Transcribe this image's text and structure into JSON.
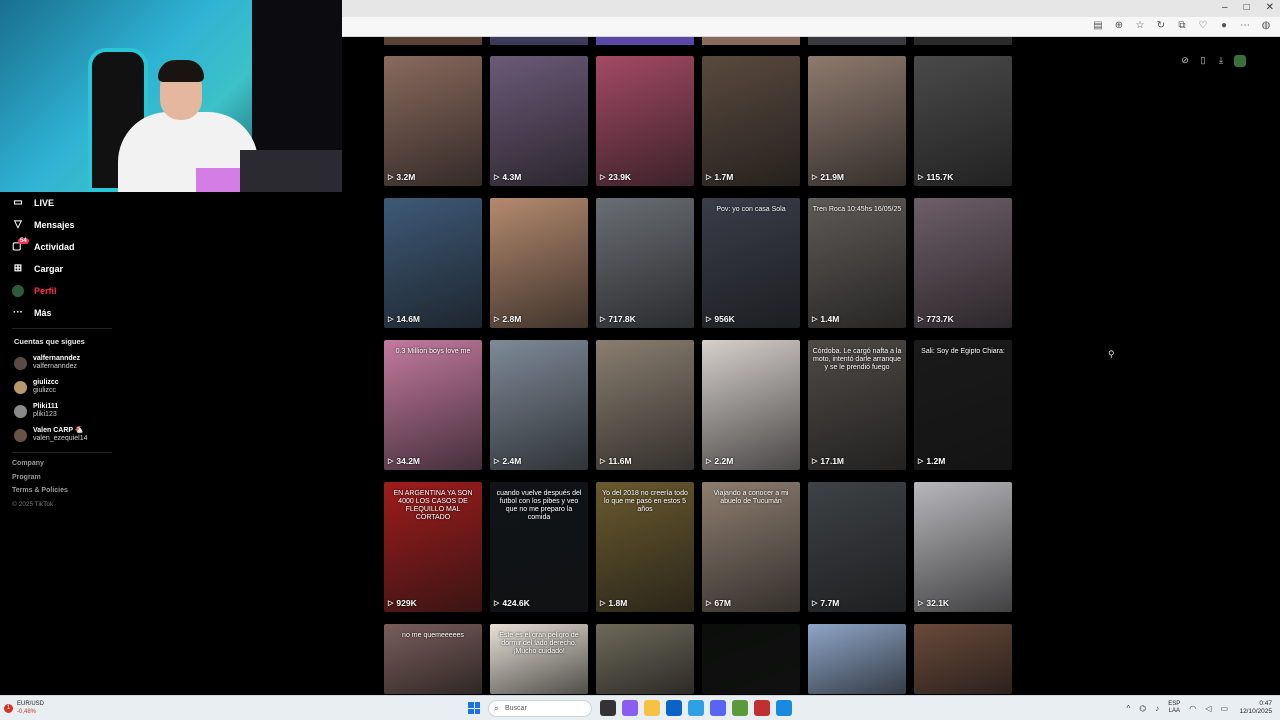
{
  "sidebar": {
    "items": [
      {
        "label": "LIVE",
        "icon": "live-tv-icon"
      },
      {
        "label": "Mensajes",
        "icon": "paper-plane-icon"
      },
      {
        "label": "Actividad",
        "icon": "inbox-icon",
        "badge": "54"
      },
      {
        "label": "Cargar",
        "icon": "plus-square-icon"
      },
      {
        "label": "Perfil",
        "icon": "avatar",
        "active": true
      },
      {
        "label": "Más",
        "icon": "more-dots-icon"
      }
    ],
    "following_title": "Cuentas que sigues",
    "following": [
      {
        "name": "valfernanndez",
        "handle": "valfernanndez"
      },
      {
        "name": "giulizcc",
        "handle": "giulizcc"
      },
      {
        "name": "Pliki111",
        "handle": "pliki123"
      },
      {
        "name": "Valen CARP 🐔",
        "handle": "valen_ezequiel14"
      }
    ],
    "footer": [
      "Company",
      "Program",
      "Terms & Policies"
    ],
    "copyright": "© 2025 TikTok"
  },
  "grid": {
    "rows": [
      [
        {
          "views": "3.2M",
          "color": "#8a6a5e"
        },
        {
          "views": "4.3M",
          "color": "#6c5a78"
        },
        {
          "views": "23.9K",
          "color": "#a44a66"
        },
        {
          "views": "1.7M",
          "color": "#5a4a3e"
        },
        {
          "views": "21.9M",
          "color": "#8e7a6e"
        },
        {
          "views": "115.7K",
          "color": "#4a4a4a"
        }
      ],
      [
        {
          "views": "14.6M",
          "color": "#3e5a78"
        },
        {
          "views": "2.8M",
          "color": "#b48a6e"
        },
        {
          "views": "717.8K",
          "color": "#6a6e74"
        },
        {
          "views": "956K",
          "color": "#3a3e4a",
          "caption": "Pov: yo con casa Sola"
        },
        {
          "views": "1.4M",
          "color": "#5e5a56",
          "caption": "Tren Roca 10:45hs 16/05/25"
        },
        {
          "views": "773.7K",
          "color": "#6e5e68"
        }
      ],
      [
        {
          "views": "34.2M",
          "color": "#c47aa0",
          "caption": "0.3 Million boys love me"
        },
        {
          "views": "2.4M",
          "color": "#7e8a98"
        },
        {
          "views": "11.6M",
          "color": "#8a7e70"
        },
        {
          "views": "2.2M",
          "color": "#d6d0cc"
        },
        {
          "views": "17.1M",
          "color": "#4e4a46",
          "caption": "Córdoba. Le cargó nafta a la moto, intentó darle arranque y se le prendió fuego"
        },
        {
          "views": "1.2M",
          "color": "#1a1a1a",
          "caption": "Sali: Soy de Egipto Chiara:"
        }
      ],
      [
        {
          "views": "929K",
          "color": "#a01c1c",
          "caption": "EN ARGENTINA YA SON 4000 LOS CASOS DE FLEQUILLO MAL CORTADO"
        },
        {
          "views": "424.6K",
          "color": "#101418",
          "caption": "cuando vuelve después del futbol con los pibes y veo que no me preparo la comida"
        },
        {
          "views": "1.8M",
          "color": "#6a5a2e",
          "caption": "Yo del 2018 no creería todo lo que me pasó en estos 5 años"
        },
        {
          "views": "67M",
          "color": "#8e7e70",
          "caption": "Viajando a conocer a mi abuelo de Tucumán"
        },
        {
          "views": "7.7M",
          "color": "#3e4246"
        },
        {
          "views": "32.1K",
          "color": "#b8b8bc"
        }
      ],
      [
        {
          "views": "",
          "color": "#7a5e5a",
          "caption": "no me quemeeeees"
        },
        {
          "views": "",
          "color": "#e8e2d6",
          "caption": "Este es el gran peligro de dormir del lado derecho. ¡Mucho cuidado!"
        },
        {
          "views": "",
          "color": "#6e6a5a"
        },
        {
          "views": "",
          "color": "#0c0e0c"
        },
        {
          "views": "",
          "color": "#8ea6c8"
        },
        {
          "views": "",
          "color": "#6a4a3a"
        }
      ]
    ]
  },
  "taskbar": {
    "stock_name": "EUR/USD",
    "stock_change": "-0,48%",
    "stock_badge": "1",
    "search_placeholder": "Buscar",
    "lang_top": "ESP",
    "lang_bottom": "LAA",
    "time": "0:47",
    "date": "12/10/2025"
  }
}
